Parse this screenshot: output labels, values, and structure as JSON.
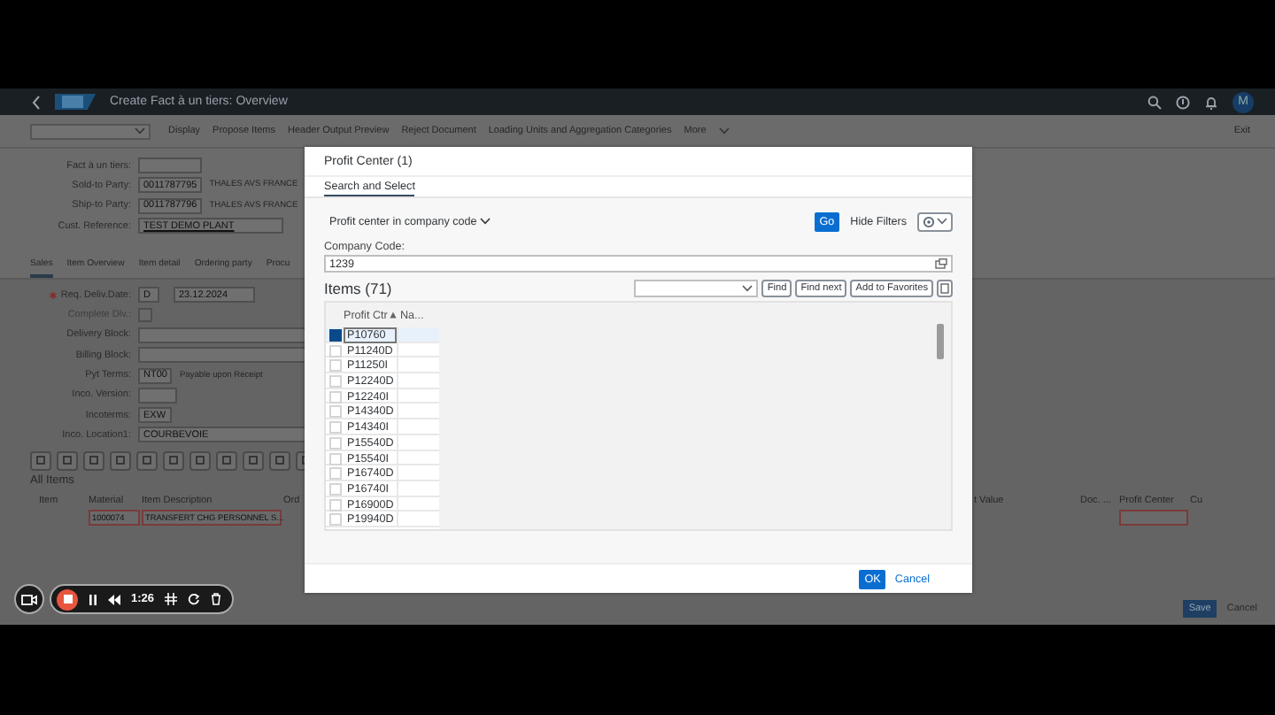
{
  "shell": {
    "title": "Create Fact à un tiers: Overview",
    "avatar": "M"
  },
  "toolbar": {
    "actions": [
      "Display",
      "Propose Items",
      "Header Output Preview",
      "Reject Document",
      "Loading Units and Aggregation Categories",
      "More"
    ],
    "exit": "Exit"
  },
  "header_fields": [
    {
      "label": "Fact à un tiers:"
    },
    {
      "label": "Sold-to Party:",
      "value": "0011787795",
      "description": "THALES AVS FRANCE"
    },
    {
      "label": "Ship-to Party:",
      "value": "0011787796",
      "description": "THALES AVS FRANCE"
    },
    {
      "label": "Cust. Reference:",
      "value": "TEST DEMO PLANT",
      "wide": true
    }
  ],
  "tabs": [
    {
      "label": "Sales",
      "selected": true
    },
    {
      "label": "Item Overview",
      "selected": false
    },
    {
      "label": "Item detail",
      "selected": false
    },
    {
      "label": "Ordering party",
      "selected": false
    },
    {
      "label": "Procu",
      "selected": false
    }
  ],
  "sales_fields": [
    {
      "kind": "date",
      "label": "Req. Deliv.Date:",
      "required": true,
      "prefix": "D",
      "value": "23.12.2024"
    },
    {
      "kind": "checkbox",
      "label": "Complete Dlv.:",
      "checked": false,
      "disabled": true
    },
    {
      "kind": "select",
      "label": "Delivery Block:"
    },
    {
      "kind": "select",
      "label": "Billing Block:"
    },
    {
      "kind": "text",
      "label": "Pyt Terms:",
      "value": "NT00",
      "description": "Payable upon Receipt"
    },
    {
      "kind": "text",
      "label": "Inco. Version:"
    },
    {
      "kind": "text",
      "label": "Incoterms:",
      "value": "EXW"
    },
    {
      "kind": "text",
      "label": "Inco. Location1:",
      "value": "COURBEVOIE",
      "wide": true
    }
  ],
  "items_table": {
    "title": "All Items",
    "columns": [
      "Item",
      "Material",
      "Item Description",
      "Ord",
      "t Value",
      "Doc. ...",
      "Profit Center",
      "Cu"
    ],
    "rows": [
      {
        "material": "1000074",
        "description": "TRANSFERT CHG PERSONNEL S..."
      }
    ]
  },
  "footer": {
    "buttons": [
      "Save",
      "Cancel"
    ]
  },
  "dialog": {
    "title": "Profit Center (1)",
    "tabs": [
      {
        "label": "Search and Select",
        "selected": true
      }
    ],
    "variant": "Profit center in company code",
    "go": "Go",
    "hide_filters": "Hide Filters",
    "filters": [
      {
        "label": "Company Code:",
        "value": "1239"
      }
    ],
    "items_title": "Items (71)",
    "search_buttons": [
      "Find",
      "Find next",
      "Add to Favorites"
    ],
    "columns": [
      "Profit Ctr",
      "Na..."
    ],
    "rows": [
      {
        "profit_center": "P10760",
        "selected": true
      },
      {
        "profit_center": "P11240D",
        "selected": false
      },
      {
        "profit_center": "P11250I",
        "selected": false
      },
      {
        "profit_center": "P12240D",
        "selected": false
      },
      {
        "profit_center": "P12240I",
        "selected": false
      },
      {
        "profit_center": "P14340D",
        "selected": false
      },
      {
        "profit_center": "P14340I",
        "selected": false
      },
      {
        "profit_center": "P15540D",
        "selected": false
      },
      {
        "profit_center": "P15540I",
        "selected": false
      },
      {
        "profit_center": "P16740D",
        "selected": false
      },
      {
        "profit_center": "P16740I",
        "selected": false
      },
      {
        "profit_center": "P16900D",
        "selected": false
      },
      {
        "profit_center": "P19940D",
        "selected": false
      }
    ],
    "buttons": [
      "OK",
      "Cancel"
    ]
  },
  "recorder": {
    "time": "1:26"
  }
}
